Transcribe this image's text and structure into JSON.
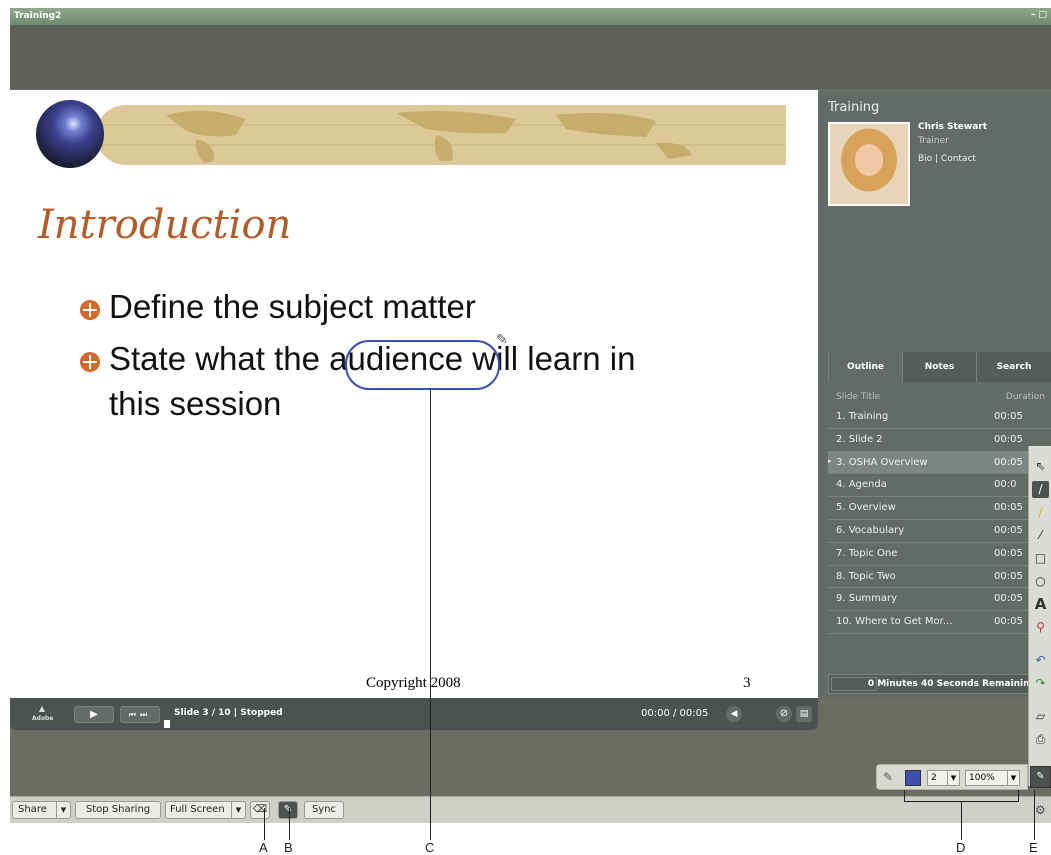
{
  "window": {
    "title": "Training2",
    "controls": "– □"
  },
  "slide": {
    "title": "Introduction",
    "bullets": [
      "Define the subject matter",
      "State what the audience will learn in",
      "this session"
    ],
    "copyright": "Copyright 2008",
    "page_number": "3",
    "ink_color": "#3d4fa8"
  },
  "playbar": {
    "logo": "Adobe",
    "status": "Slide 3 / 10 | Stopped",
    "time": "00:00 / 00:05"
  },
  "sidebar": {
    "heading": "Training",
    "presenter": {
      "name": "Chris Stewart",
      "role": "Trainer",
      "links": "Bio | Contact"
    },
    "tabs": [
      "Outline",
      "Notes",
      "Search"
    ],
    "columns": {
      "title": "Slide Title",
      "duration": "Duration"
    },
    "rows": [
      {
        "title": "1. Training",
        "duration": "00:05"
      },
      {
        "title": "2. Slide 2",
        "duration": "00:05"
      },
      {
        "title": "3. OSHA Overview",
        "duration": "00:05"
      },
      {
        "title": "4. Agenda",
        "duration": "00:0"
      },
      {
        "title": "5. Overview",
        "duration": "00:05"
      },
      {
        "title": "6. Vocabulary",
        "duration": "00:05"
      },
      {
        "title": "7. Topic One",
        "duration": "00:05"
      },
      {
        "title": "8. Topic Two",
        "duration": "00:05"
      },
      {
        "title": "9. Summary",
        "duration": "00:05"
      },
      {
        "title": "10. Where to Get Mor...",
        "duration": "00:05"
      }
    ],
    "remaining": "0 Minutes 40 Seconds Remaining"
  },
  "tools": [
    "pointer-icon",
    "marker-icon",
    "highlighter-icon",
    "line-icon",
    "rectangle-icon",
    "ellipse-icon",
    "text-icon",
    "stamp-icon",
    "undo-icon",
    "redo-icon",
    "eraser-icon",
    "print-icon"
  ],
  "annotation_bar": {
    "line_width": "2",
    "zoom": "100%",
    "color": "#3d4fa8"
  },
  "bottombar": {
    "share": "Share",
    "stop_sharing": "Stop Sharing",
    "full_screen": "Full Screen",
    "sync": "Sync"
  },
  "callouts": {
    "a": "A",
    "b": "B",
    "c": "C",
    "d": "D",
    "e": "E"
  }
}
